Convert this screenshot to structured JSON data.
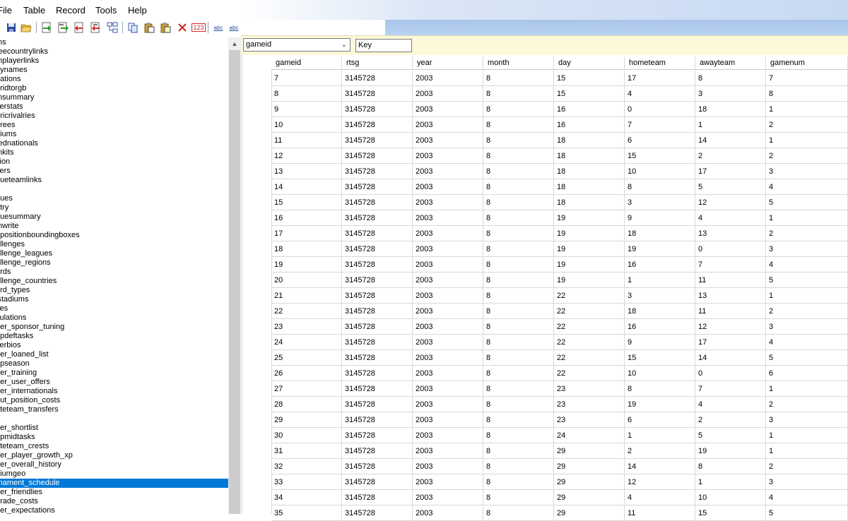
{
  "menu": [
    "File",
    "Table",
    "Record",
    "Tools",
    "Help"
  ],
  "toolbar": {
    "icons": [
      "save-icon",
      "open-folder-icon",
      "import-icon",
      "export-icon",
      "delete-record-icon",
      "insert-record-icon",
      "relations-icon",
      "copy-icon",
      "paste-icon",
      "paste-special-icon",
      "clear-icon",
      "renumber-icon",
      "spellcheck-icon",
      "spellcheck-all-icon"
    ],
    "renumber_glyph": "123",
    "spell_glyph": "abc"
  },
  "tree": {
    "items": [
      "ms",
      "reecountrylinks",
      "mplayerlinks",
      "eynames",
      "nations",
      "oridtorgb",
      "msummary",
      "verstats",
      "oricrivalries",
      "erees",
      "diums",
      "rednationals",
      "mkits",
      "sion",
      "vers",
      "gueteamlinks",
      "",
      "gues",
      "ntry",
      "guesummary",
      "mwrite",
      "dpositionboundingboxes",
      "allenges",
      "allenge_leagues",
      "allenge_regions",
      "ards",
      "allenge_countries",
      "ard_types",
      "lstadiums",
      "ves",
      "culations",
      "eer_sponsor_tuning",
      "opdeftasks",
      "verbios",
      "eer_loaned_list",
      "opseason",
      "eer_training",
      "eer_user_offers",
      "eer_internationals",
      "out_position_costs",
      "ateteam_transfers",
      "",
      "eer_shortlist",
      "opmidtasks",
      "ateteam_crests",
      "eer_player_growth_xp",
      "eer_overall_history",
      "diumgeo",
      "rnament_schedule",
      "eer_friendlies",
      "grade_costs",
      "eer_expectations"
    ],
    "selected_index": 48
  },
  "filter": {
    "field_value": "gameid",
    "key_placeholder": "Key"
  },
  "table": {
    "columns": [
      "gameid",
      "rtsg",
      "year",
      "month",
      "day",
      "hometeam",
      "awayteam",
      "gamenum"
    ],
    "rows": [
      [
        "7",
        "3145728",
        "2003",
        "8",
        "15",
        "17",
        "8",
        "7"
      ],
      [
        "8",
        "3145728",
        "2003",
        "8",
        "15",
        "4",
        "3",
        "8"
      ],
      [
        "9",
        "3145728",
        "2003",
        "8",
        "16",
        "0",
        "18",
        "1"
      ],
      [
        "10",
        "3145728",
        "2003",
        "8",
        "16",
        "7",
        "1",
        "2"
      ],
      [
        "11",
        "3145728",
        "2003",
        "8",
        "18",
        "6",
        "14",
        "1"
      ],
      [
        "12",
        "3145728",
        "2003",
        "8",
        "18",
        "15",
        "2",
        "2"
      ],
      [
        "13",
        "3145728",
        "2003",
        "8",
        "18",
        "10",
        "17",
        "3"
      ],
      [
        "14",
        "3145728",
        "2003",
        "8",
        "18",
        "8",
        "5",
        "4"
      ],
      [
        "15",
        "3145728",
        "2003",
        "8",
        "18",
        "3",
        "12",
        "5"
      ],
      [
        "16",
        "3145728",
        "2003",
        "8",
        "19",
        "9",
        "4",
        "1"
      ],
      [
        "17",
        "3145728",
        "2003",
        "8",
        "19",
        "18",
        "13",
        "2"
      ],
      [
        "18",
        "3145728",
        "2003",
        "8",
        "19",
        "19",
        "0",
        "3"
      ],
      [
        "19",
        "3145728",
        "2003",
        "8",
        "19",
        "16",
        "7",
        "4"
      ],
      [
        "20",
        "3145728",
        "2003",
        "8",
        "19",
        "1",
        "11",
        "5"
      ],
      [
        "21",
        "3145728",
        "2003",
        "8",
        "22",
        "3",
        "13",
        "1"
      ],
      [
        "22",
        "3145728",
        "2003",
        "8",
        "22",
        "18",
        "11",
        "2"
      ],
      [
        "23",
        "3145728",
        "2003",
        "8",
        "22",
        "16",
        "12",
        "3"
      ],
      [
        "24",
        "3145728",
        "2003",
        "8",
        "22",
        "9",
        "17",
        "4"
      ],
      [
        "25",
        "3145728",
        "2003",
        "8",
        "22",
        "15",
        "14",
        "5"
      ],
      [
        "26",
        "3145728",
        "2003",
        "8",
        "22",
        "10",
        "0",
        "6"
      ],
      [
        "27",
        "3145728",
        "2003",
        "8",
        "23",
        "8",
        "7",
        "1"
      ],
      [
        "28",
        "3145728",
        "2003",
        "8",
        "23",
        "19",
        "4",
        "2"
      ],
      [
        "29",
        "3145728",
        "2003",
        "8",
        "23",
        "6",
        "2",
        "3"
      ],
      [
        "30",
        "3145728",
        "2003",
        "8",
        "24",
        "1",
        "5",
        "1"
      ],
      [
        "31",
        "3145728",
        "2003",
        "8",
        "29",
        "2",
        "19",
        "1"
      ],
      [
        "32",
        "3145728",
        "2003",
        "8",
        "29",
        "14",
        "8",
        "2"
      ],
      [
        "33",
        "3145728",
        "2003",
        "8",
        "29",
        "12",
        "1",
        "3"
      ],
      [
        "34",
        "3145728",
        "2003",
        "8",
        "29",
        "4",
        "10",
        "4"
      ],
      [
        "35",
        "3145728",
        "2003",
        "8",
        "29",
        "11",
        "15",
        "5"
      ]
    ]
  },
  "colors": {
    "selection": "#0078d7",
    "filter_bar": "#fcf8d8",
    "toolbar_blue": "#b9d2f1"
  }
}
